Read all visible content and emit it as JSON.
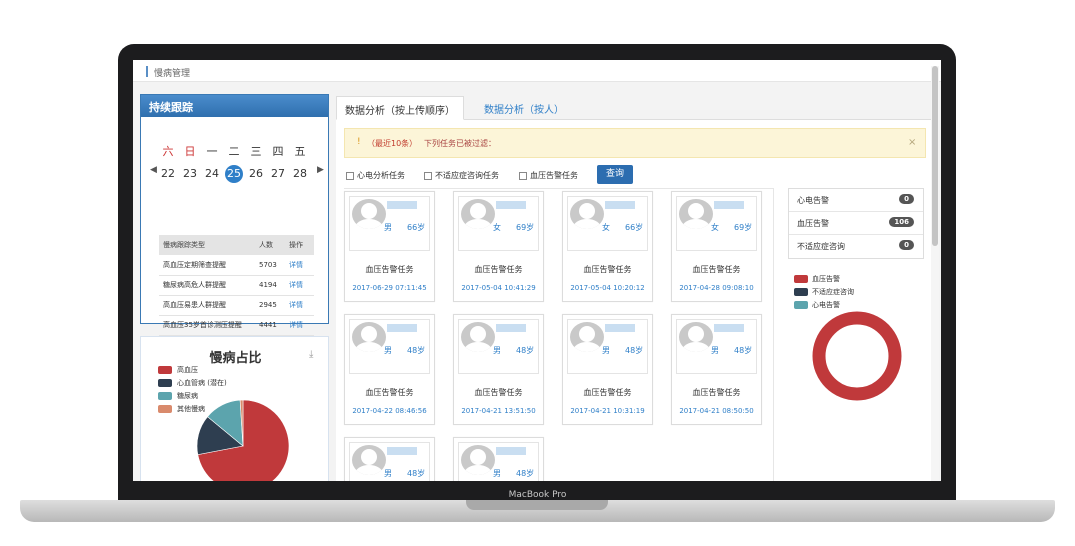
{
  "breadcrumb": "慢病管理",
  "follow_panel": {
    "title": "持续跟踪",
    "weekdays": [
      "六",
      "日",
      "一",
      "二",
      "三",
      "四",
      "五"
    ],
    "days": [
      "22",
      "23",
      "24",
      "25",
      "26",
      "27",
      "28"
    ],
    "today": "25",
    "table": {
      "headers": [
        "慢病跟踪类型",
        "人数",
        "操作"
      ],
      "rows": [
        [
          "高血压定期筛查提醒",
          "5703",
          "详情"
        ],
        [
          "糖尿病高危人群提醒",
          "4194",
          "详情"
        ],
        [
          "高血压易患人群提醒",
          "2945",
          "详情"
        ],
        [
          "高血压35岁首诊测压提醒",
          "4441",
          "详情"
        ]
      ]
    }
  },
  "pie_panel": {
    "title": "慢病占比",
    "legend": [
      {
        "label": "高血压",
        "color": "#c0393b"
      },
      {
        "label": "心血管病 (潜在)",
        "color": "#2e3e50"
      },
      {
        "label": "糖尿病",
        "color": "#5ca4ad"
      },
      {
        "label": "其他慢病",
        "color": "#d98a6c"
      }
    ],
    "values": [
      72,
      14,
      13,
      1
    ]
  },
  "tabs": [
    "数据分析（按上传顺序）",
    "数据分析（按人）"
  ],
  "alert": {
    "icon": "!",
    "highlight": "（最近10条）",
    "text": "下列任务已被过滤：",
    "close": "×"
  },
  "filters": {
    "options": [
      "心电分析任务",
      "不适应症咨询任务",
      "血压告警任务"
    ],
    "query_label": "查询"
  },
  "cards": [
    {
      "gender": "男",
      "age": "66岁",
      "task": "血压告警任务",
      "time": "2017-06-29 07:11:45"
    },
    {
      "gender": "女",
      "age": "69岁",
      "task": "血压告警任务",
      "time": "2017-05-04 10:41:29"
    },
    {
      "gender": "女",
      "age": "66岁",
      "task": "血压告警任务",
      "time": "2017-05-04 10:20:12"
    },
    {
      "gender": "女",
      "age": "69岁",
      "task": "血压告警任务",
      "time": "2017-04-28 09:08:10"
    },
    {
      "gender": "男",
      "age": "48岁",
      "task": "血压告警任务",
      "time": "2017-04-22 08:46:56"
    },
    {
      "gender": "男",
      "age": "48岁",
      "task": "血压告警任务",
      "time": "2017-04-21 13:51:50"
    },
    {
      "gender": "男",
      "age": "48岁",
      "task": "血压告警任务",
      "time": "2017-04-21 10:31:19"
    },
    {
      "gender": "男",
      "age": "48岁",
      "task": "血压告警任务",
      "time": "2017-04-21 08:50:50"
    },
    {
      "gender": "男",
      "age": "48岁",
      "task": "",
      "time": ""
    },
    {
      "gender": "男",
      "age": "48岁",
      "task": "",
      "time": ""
    }
  ],
  "side_list": [
    {
      "label": "心电告警",
      "count": "0"
    },
    {
      "label": "血压告警",
      "count": "106"
    },
    {
      "label": "不适应症咨询",
      "count": "0"
    }
  ],
  "donut": {
    "legend": [
      {
        "label": "血压告警",
        "color": "#c0393b"
      },
      {
        "label": "不适应症咨询",
        "color": "#2e3e50"
      },
      {
        "label": "心电告警",
        "color": "#5ca4ad"
      }
    ],
    "values": [
      106,
      0,
      0
    ]
  },
  "laptop_label": "MacBook Pro"
}
